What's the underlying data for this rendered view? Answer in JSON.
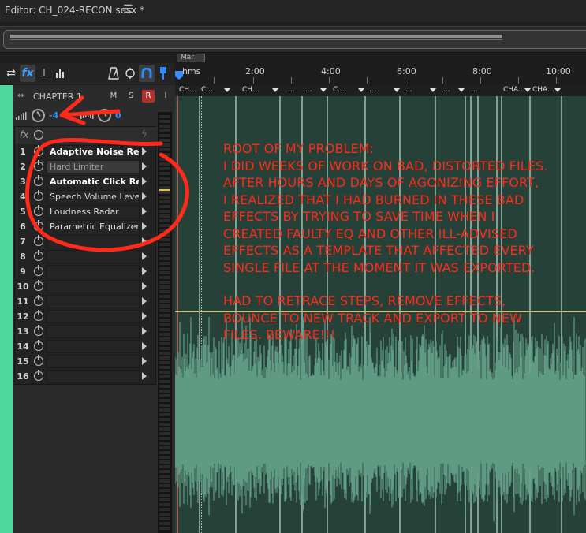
{
  "window": {
    "title": "Editor: CH_024-RECON.sesx *",
    "menu_icon": "hamburger-menu-icon"
  },
  "toolbar": {
    "buttons": [
      {
        "name": "io-toggle",
        "icon": "swap-arrows-icon",
        "glyph": "⇄"
      },
      {
        "name": "effects-toggle",
        "icon": "fx-icon",
        "glyph": "fx"
      },
      {
        "name": "sends-toggle",
        "icon": "sends-icon",
        "glyph": "⊣"
      },
      {
        "name": "eq-toggle",
        "icon": "bar-chart-icon",
        "glyph": "▮"
      },
      {
        "name": "metronome",
        "icon": "metronome-icon",
        "glyph": "⍋"
      },
      {
        "name": "auto-select",
        "icon": "hand-select-icon",
        "glyph": "⛏"
      },
      {
        "name": "snap",
        "icon": "magnet-icon",
        "glyph": "∩"
      },
      {
        "name": "marker",
        "icon": "pin-icon",
        "glyph": "⚲"
      }
    ]
  },
  "track": {
    "name": "CHAPTER 1",
    "mute": "M",
    "solo": "S",
    "record": "R",
    "input": "I",
    "volume": "-4",
    "pan": "0",
    "accent_color": "#4fd7a0"
  },
  "effects_rack": {
    "header_fx": "fx",
    "slots": [
      {
        "num": "1",
        "label": "Adaptive Noise Reducti",
        "style": "bold"
      },
      {
        "num": "2",
        "label": "Hard Limiter",
        "style": "dim"
      },
      {
        "num": "3",
        "label": "Automatic Click Remov",
        "style": "bold"
      },
      {
        "num": "4",
        "label": "Speech Volume Leveler",
        "style": "normal"
      },
      {
        "num": "5",
        "label": "Loudness Radar",
        "style": "normal"
      },
      {
        "num": "6",
        "label": "Parametric Equalizer",
        "style": "normal"
      },
      {
        "num": "7",
        "label": "",
        "style": "normal"
      },
      {
        "num": "8",
        "label": "",
        "style": "normal"
      },
      {
        "num": "9",
        "label": "",
        "style": "normal"
      },
      {
        "num": "10",
        "label": "",
        "style": "normal"
      },
      {
        "num": "11",
        "label": "",
        "style": "normal"
      },
      {
        "num": "12",
        "label": "",
        "style": "normal"
      },
      {
        "num": "13",
        "label": "",
        "style": "normal"
      },
      {
        "num": "14",
        "label": "",
        "style": "normal"
      },
      {
        "num": "15",
        "label": "",
        "style": "normal"
      },
      {
        "num": "16",
        "label": "",
        "style": "normal"
      }
    ]
  },
  "timeline": {
    "marker_label": "Mar",
    "time_unit": "hms",
    "ticks": [
      "2:00",
      "4:00",
      "6:00",
      "8:00",
      "10:00"
    ],
    "clips": [
      "CH...",
      "C...",
      "CH...",
      "...",
      "...",
      "C...",
      "...",
      "...",
      "...",
      "...",
      "CHA...",
      "CHA..."
    ],
    "wave_color": "#5f9b84",
    "bg_color": "#264238"
  },
  "annotation": {
    "color": "#ff2a1a",
    "lines": [
      "ROOT OF MY PROBLEM:",
      "I DID WEEKS OF WORK ON BAD, DISTORTED FILES.",
      "AFTER HOURS AND DAYS OF AGONIZING EFFORT,",
      "I REALIZED THAT I HAD BURNED IN THESE BAD",
      "EFFECTS BY TRYING TO SAVE TIME WHEN I",
      "CREATED FAULTY EQ AND OTHER ILL-ADVISED",
      "EFFECTS AS A TEMPLATE THAT AFFECTED EVERY",
      "SINGLE FILE AT THE MOMENT IT WAS EXPORTED."
    ],
    "lines2": [
      "HAD TO RETRACE STEPS, REMOVE EFFECTS,",
      "BOUNCE TO NEW TRACK AND EXPORT TO NEW",
      "FILES.  BEWARE!!!"
    ]
  }
}
